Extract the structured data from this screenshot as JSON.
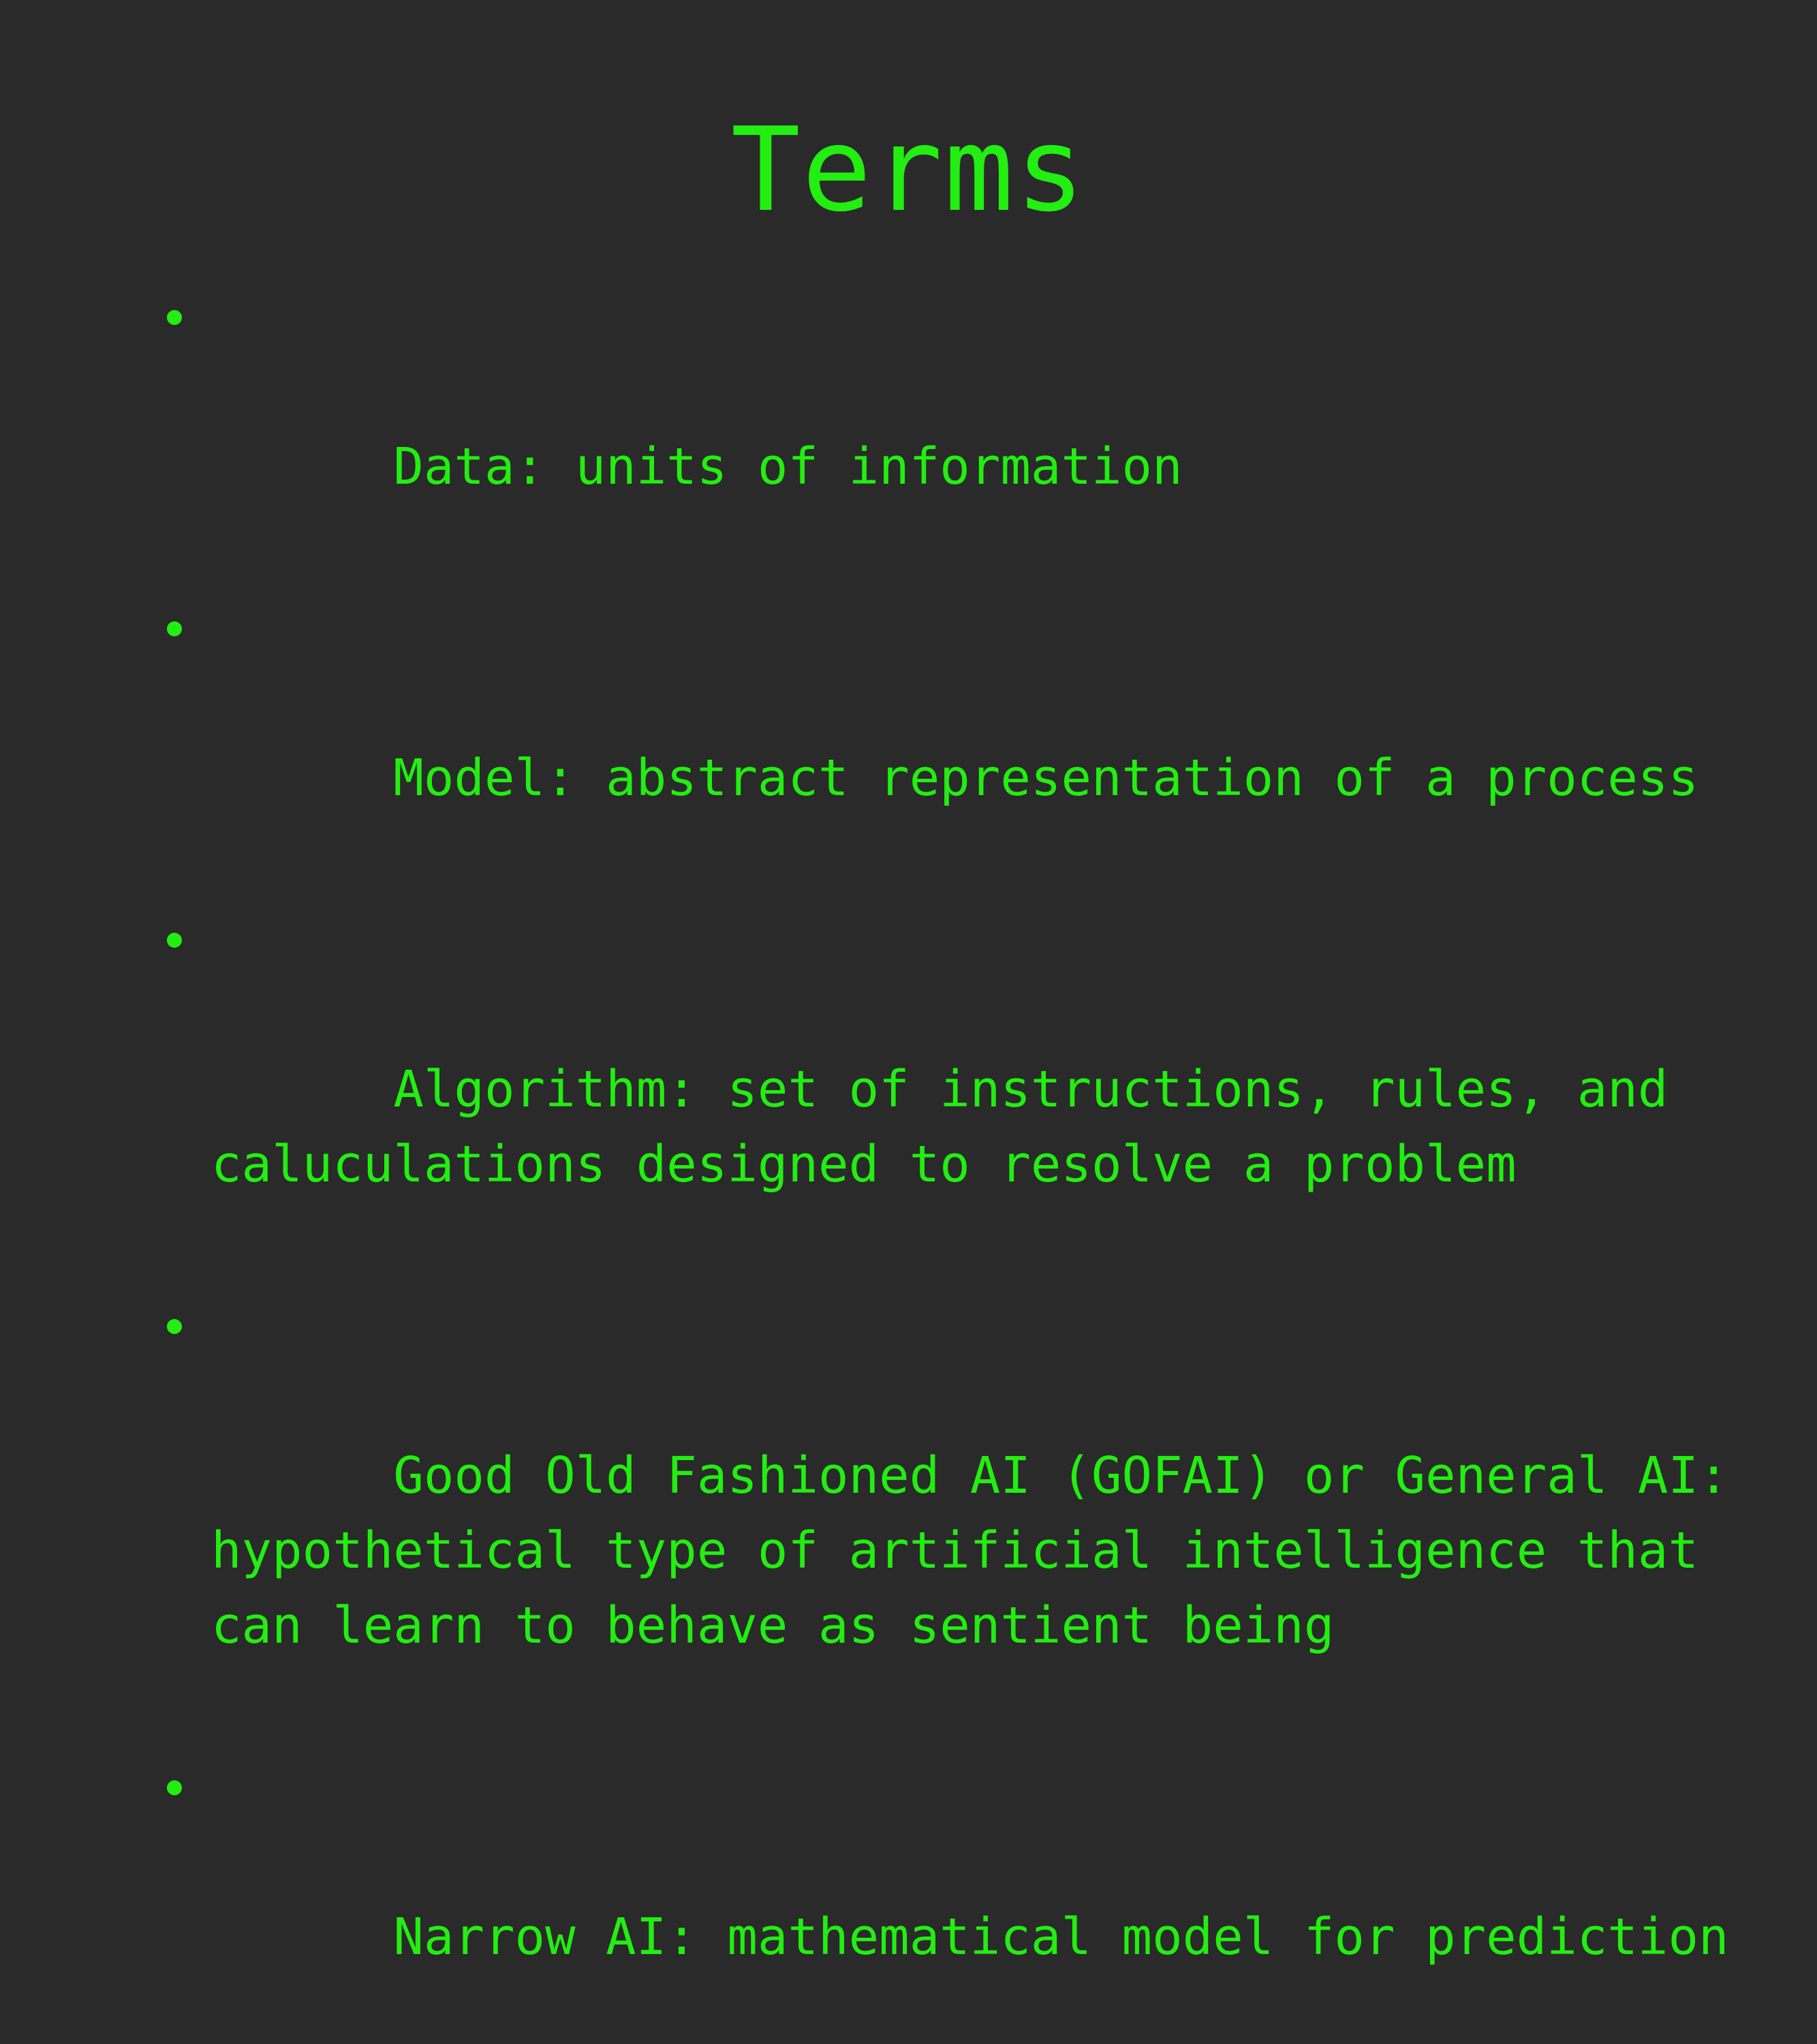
{
  "slide": {
    "title": "Terms",
    "bullets": [
      "Data: units of information",
      "Model: abstract representation of a process",
      "Algorithm: set of instructions, rules, and\ncaluculations designed to resolve a problem",
      "Good Old Fashioned AI (GOFAI) or General AI:\nhypothetical type of artificial intelligence that\ncan learn to behave as sentient being",
      "Narrow AI: mathematical model for prediction"
    ]
  },
  "colors": {
    "background": "#2a2a2a",
    "text": "#22ee11"
  }
}
